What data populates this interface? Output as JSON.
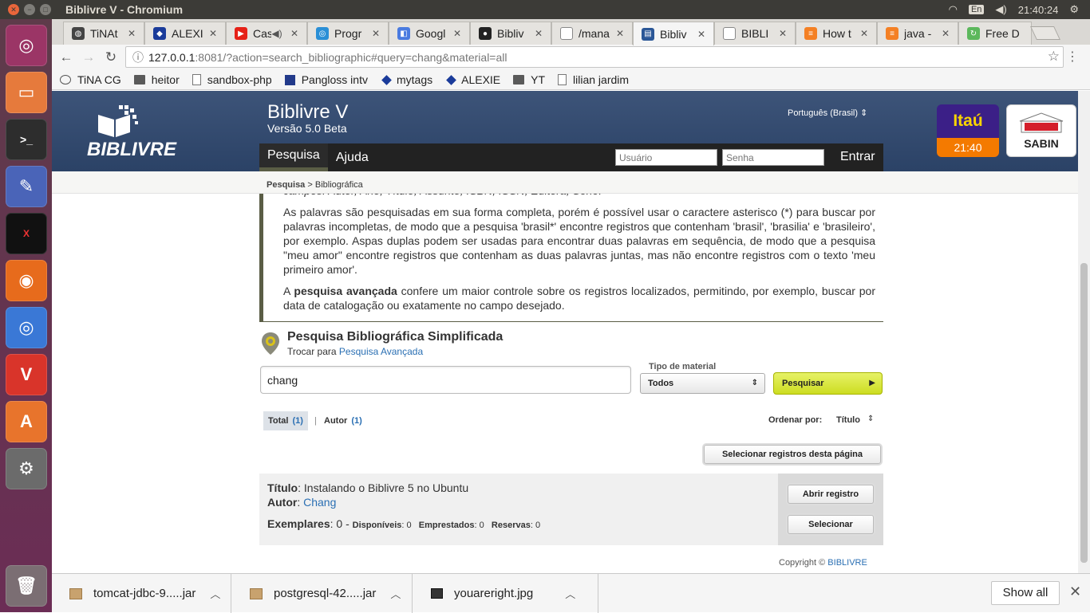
{
  "os": {
    "window_title": "Biblivre V - Chromium",
    "keyboard_layout": "En",
    "clock": "21:40:24"
  },
  "tabs": [
    {
      "label": "TiNAt",
      "icon": "tina-icon",
      "color": "#444444"
    },
    {
      "label": "ALEXI",
      "icon": "alexie-icon",
      "color": "#1a3b9a"
    },
    {
      "label": "Cas",
      "icon": "youtube-icon",
      "color": "#e62117"
    },
    {
      "label": "Progr",
      "icon": "progress-icon",
      "color": "#2a8fd6"
    },
    {
      "label": "Googl",
      "icon": "google-icon",
      "color": "#4a7be0"
    },
    {
      "label": "Bibliv",
      "icon": "github-icon",
      "color": "#222222"
    },
    {
      "label": "/mana",
      "icon": "page-icon",
      "color": "#888888"
    },
    {
      "label": "Bibliv",
      "icon": "biblivre-icon",
      "color": "#2b5797",
      "active": true
    },
    {
      "label": "BIBLI",
      "icon": "page-icon",
      "color": "#888888"
    },
    {
      "label": "How t",
      "icon": "stackoverflow-icon",
      "color": "#f48024"
    },
    {
      "label": "java -",
      "icon": "stackoverflow-icon",
      "color": "#f48024"
    },
    {
      "label": "Free D",
      "icon": "refresh-icon",
      "color": "#5cb85c"
    }
  ],
  "address": {
    "host": "127.0.0.1",
    "rest": ":8081/?action=search_bibliographic#query=chang&material=all"
  },
  "bookmarks": [
    {
      "label": "TiNA CG",
      "icon": "tina-icon"
    },
    {
      "label": "heitor",
      "icon": "folder-icon"
    },
    {
      "label": "sandbox-php",
      "icon": "page-icon"
    },
    {
      "label": "Pangloss intv",
      "icon": "pangloss-icon"
    },
    {
      "label": "mytags",
      "icon": "alexie-icon"
    },
    {
      "label": "ALEXIE",
      "icon": "alexie-icon"
    },
    {
      "label": "YT",
      "icon": "folder-icon"
    },
    {
      "label": "lilian jardim",
      "icon": "page-icon"
    }
  ],
  "app": {
    "logo_text": "BIBLIVRE",
    "title": "Biblivre V",
    "version": "Versão 5.0 Beta",
    "language": "Português (Brasil)",
    "nav": {
      "search": "Pesquisa",
      "help": "Ajuda"
    },
    "login": {
      "user_placeholder": "Usuário",
      "pass_placeholder": "Senha",
      "button": "Entrar"
    },
    "badges": {
      "itau_label": "Itaú",
      "itau_time": "21:40",
      "sabin_label": "SABIN"
    },
    "breadcrumb": {
      "root": "Pesquisa",
      "sep": " > ",
      "current": "Bibliográfica"
    }
  },
  "help": {
    "cut_line": "campos: Autor, Ano, Título, Assunto, ISBN, ISSN, Editora, Série.",
    "p1": "As palavras são pesquisadas em sua forma completa, porém é possível usar o caractere asterisco (*) para buscar por palavras incompletas, de modo que a pesquisa 'brasil*' encontre registros que contenham 'brasil', 'brasilia' e 'brasileiro', por exemplo. Aspas duplas podem ser usadas para encontrar duas palavras em sequência, de modo que a pesquisa \"meu amor\" encontre registros que contenham as duas palavras juntas, mas não encontre registros com o texto 'meu primeiro amor'.",
    "p2_strong": "pesquisa avançada",
    "p2_pre": "A ",
    "p2_post": " confere um maior controle sobre os registros localizados, permitindo, por exemplo, buscar por data de catalogação ou exatamente no campo desejado."
  },
  "search": {
    "title": "Pesquisa Bibliográfica Simplificada",
    "switch_prefix": "Trocar para ",
    "switch_link": "Pesquisa Avançada",
    "query": "chang",
    "material_label": "Tipo de material",
    "material_value": "Todos",
    "button": "Pesquisar"
  },
  "facets": {
    "total_label": "Total",
    "total_count": "(1)",
    "sep": "|",
    "author_label": "Autor",
    "author_count": "(1)",
    "sort_label": "Ordenar por:",
    "sort_value": "Título"
  },
  "select_page_button": "Selecionar registros desta página",
  "result": {
    "title_label": "Título",
    "title_value": ": Instalando o Biblivre 5 no Ubuntu",
    "author_label": "Autor",
    "author_value": "Chang",
    "copies_label": "Exemplares",
    "copies_value": ": 0 -",
    "available_label": "Disponíveis",
    "available_value": ": 0",
    "lent_label": "Emprestados",
    "lent_value": ": 0",
    "reserved_label": "Reservas",
    "reserved_value": ": 0",
    "open_button": "Abrir registro",
    "select_button": "Selecionar"
  },
  "footer": {
    "copyright": "Copyright © ",
    "link": "BIBLIVRE"
  },
  "downloads": {
    "items": [
      {
        "name": "tomcat-jdbc-9.....jar",
        "icon": "archive-icon"
      },
      {
        "name": "postgresql-42.....jar",
        "icon": "archive-icon"
      },
      {
        "name": "youareright.jpg",
        "icon": "image-icon"
      }
    ],
    "show_all": "Show all"
  }
}
